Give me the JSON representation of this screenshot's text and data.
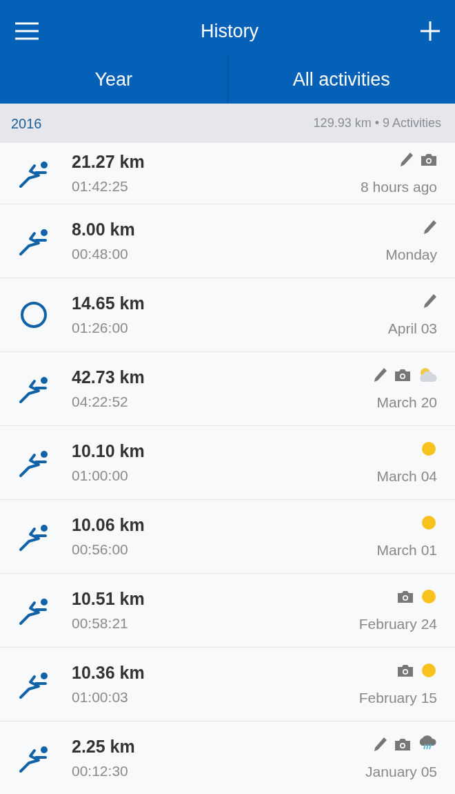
{
  "header": {
    "title": "History"
  },
  "tabs": [
    {
      "label": "Year"
    },
    {
      "label": "All activities"
    }
  ],
  "section": {
    "year": "2016",
    "summary": "129.93 km • 9 Activities"
  },
  "activities": [
    {
      "kind": "run",
      "distance": "21.27 km",
      "duration": "01:42:25",
      "date": "8 hours ago",
      "edited": true,
      "photo": true
    },
    {
      "kind": "run",
      "distance": "8.00 km",
      "duration": "00:48:00",
      "date": "Monday",
      "edited": true,
      "photo": false
    },
    {
      "kind": "other",
      "distance": "14.65 km",
      "duration": "01:26:00",
      "date": "April 03",
      "edited": true,
      "photo": false
    },
    {
      "kind": "run",
      "distance": "42.73 km",
      "duration": "04:22:52",
      "date": "March 20",
      "edited": true,
      "photo": true,
      "weather": {
        "kind": "partly-cloudy"
      }
    },
    {
      "kind": "run",
      "distance": "10.10 km",
      "duration": "01:00:00",
      "date": "March 04",
      "edited": false,
      "photo": false,
      "weather": {
        "kind": "sunny"
      }
    },
    {
      "kind": "run",
      "distance": "10.06 km",
      "duration": "00:56:00",
      "date": "March 01",
      "edited": false,
      "photo": false,
      "weather": {
        "kind": "sunny"
      }
    },
    {
      "kind": "run",
      "distance": "10.51 km",
      "duration": "00:58:21",
      "date": "February 24",
      "edited": false,
      "photo": true,
      "weather": {
        "kind": "sunny"
      }
    },
    {
      "kind": "run",
      "distance": "10.36 km",
      "duration": "01:00:03",
      "date": "February 15",
      "edited": false,
      "photo": true,
      "weather": {
        "kind": "sunny"
      }
    },
    {
      "kind": "run",
      "distance": "2.25 km",
      "duration": "00:12:30",
      "date": "January 05",
      "edited": true,
      "photo": true,
      "weather": {
        "kind": "rain"
      }
    }
  ]
}
